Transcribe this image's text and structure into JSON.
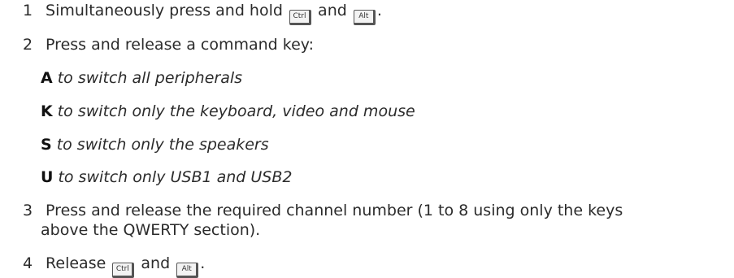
{
  "steps": [
    {
      "number": "1",
      "text_before": "Simultaneously press and hold",
      "key1": "Ctrl",
      "connector": "and",
      "key2": "Alt",
      "text_after": "."
    },
    {
      "number": "2",
      "text": "Press and release a command key:"
    },
    {
      "number": "3",
      "line1": "Press and release the required channel number (1 to 8 using only the keys",
      "line2": "above the QWERTY section)."
    },
    {
      "number": "4",
      "text_before": "Release",
      "key1": "Ctrl",
      "connector": "and",
      "key2": "Alt",
      "text_after": "."
    }
  ],
  "commands": [
    {
      "key": "A",
      "description": "to switch all peripherals"
    },
    {
      "key": "K",
      "description": "to switch only the keyboard, video and mouse"
    },
    {
      "key": "S",
      "description": "to switch only the speakers"
    },
    {
      "key": "U",
      "description": "to switch only USB1 and USB2"
    }
  ]
}
